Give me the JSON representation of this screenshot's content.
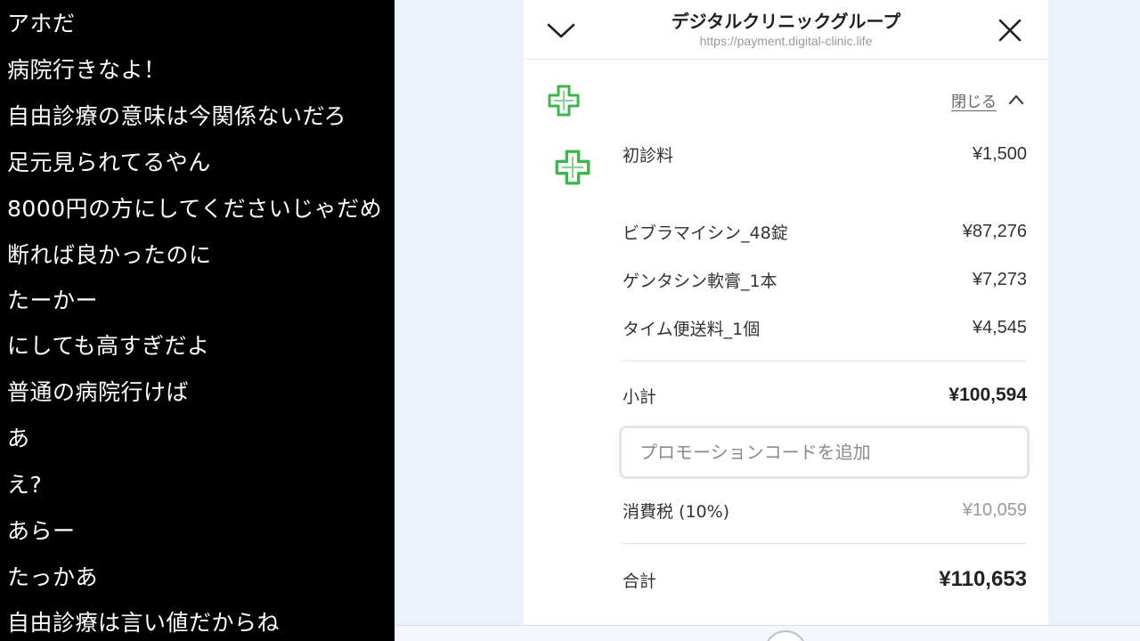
{
  "comments": [
    "アホだ",
    "病院行きなよ！",
    "自由診療の意味は今関係ないだろ",
    "足元見られてるやん",
    "8000円の方にしてくださいじゃだめ",
    "断れば良かったのに",
    "たーかー",
    "にしても高すぎだよ",
    "普通の病院行けば",
    "あ",
    "え?",
    "あらー",
    "たっかあ",
    "自由診療は言い値だからね"
  ],
  "header": {
    "title": "デジタルクリニックグループ",
    "url": "https://payment.digital-clinic.life"
  },
  "summary": {
    "collapse_label": "閉じる",
    "items": [
      {
        "name": "初診料",
        "amount": "¥1,500"
      },
      {
        "name": "ビブラマイシン_48錠",
        "amount": "¥87,276"
      },
      {
        "name": "ゲンタシン軟膏_1本",
        "amount": "¥7,273"
      },
      {
        "name": "タイム便送料_1個",
        "amount": "¥4,545"
      }
    ],
    "subtotal_label": "小計",
    "subtotal_amount": "¥100,594",
    "promo_placeholder": "プロモーションコードを追加",
    "tax_label": "消費税 (10%)",
    "tax_amount": "¥10,059",
    "total_label": "合計",
    "total_amount": "¥110,653"
  },
  "colors": {
    "logo_green": "#3cb84a",
    "comment_bg": "#000000"
  },
  "icons": [
    "chevron-down-icon",
    "close-icon",
    "clinic-cross-logo",
    "chevron-up-icon"
  ]
}
